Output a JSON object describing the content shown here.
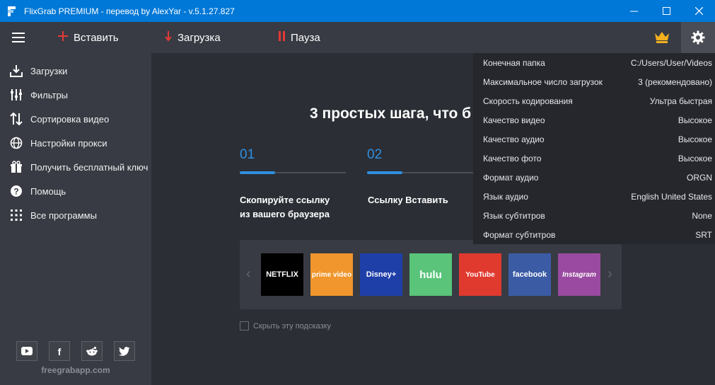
{
  "window": {
    "title": "FlixGrab PREMIUM - перевод by AlexYar - v.5.1.27.827",
    "controls": {
      "minimize": "—",
      "maximize": "☐",
      "close": "✕"
    }
  },
  "toolbar": {
    "paste_label": "Вставить",
    "download_label": "Загрузка",
    "pause_label": "Пауза",
    "icons": {
      "menu": "hamburger-icon",
      "paste": "plus-icon",
      "download": "arrow-down-icon",
      "pause": "pause-icon",
      "premium": "crown-icon",
      "settings": "gear-icon"
    },
    "colors": {
      "accent_red": "#e53935",
      "crown": "#f2b01e"
    }
  },
  "sidebar": {
    "items": [
      {
        "label": "Загрузки",
        "icon": "download-icon"
      },
      {
        "label": "Фильтры",
        "icon": "filters-icon"
      },
      {
        "label": "Сортировка видео",
        "icon": "sort-icon"
      },
      {
        "label": "Настройки прокси",
        "icon": "globe-icon"
      },
      {
        "label": "Получить бесплатный ключ",
        "icon": "gift-icon"
      },
      {
        "label": "Помощь",
        "icon": "help-icon"
      },
      {
        "label": "Все программы",
        "icon": "grid-icon"
      }
    ],
    "social": [
      "youtube-icon",
      "facebook-icon",
      "reddit-icon",
      "twitter-icon"
    ],
    "site": "freegrabapp.com"
  },
  "main": {
    "title": "3 простых шага, что б",
    "steps": [
      {
        "num": "01",
        "text_line1": "Скопируйте ссылку",
        "text_line2": "из вашего браузера"
      },
      {
        "num": "02",
        "text_line1": "Ссылку Вставить",
        "text_line2": ""
      }
    ],
    "services": [
      {
        "label": "NETFLIX",
        "color": "#000000",
        "text_color": "#ffffff"
      },
      {
        "label": "prime video",
        "color": "#f0962c",
        "text_color": "#ffffff"
      },
      {
        "label": "Disney+",
        "color": "#1f3fa8",
        "text_color": "#ffffff"
      },
      {
        "label": "hulu",
        "color": "#59c47a",
        "text_color": "#ffffff"
      },
      {
        "label": "YouTube",
        "color": "#e03a2f",
        "text_color": "#ffffff"
      },
      {
        "label": "facebook",
        "color": "#3b5ba5",
        "text_color": "#ffffff"
      },
      {
        "label": "Instagram",
        "color": "#9a4aa0",
        "text_color": "#ffffff"
      }
    ],
    "hide_hint_label": "Скрыть эту подсказку"
  },
  "settings_panel": [
    {
      "label": "Конечная папка",
      "value": "C:/Users/User/Videos"
    },
    {
      "label": "Максимальное число загрузок",
      "value": "3 (рекомендовано)"
    },
    {
      "label": "Скорость кодирования",
      "value": "Ультра быстрая"
    },
    {
      "label": "Качество видео",
      "value": "Высокое"
    },
    {
      "label": "Качество аудио",
      "value": "Высокое"
    },
    {
      "label": "Качество фото",
      "value": "Высокое"
    },
    {
      "label": "Формат аудио",
      "value": "ORGN"
    },
    {
      "label": "Язык аудио",
      "value": "English United States"
    },
    {
      "label": "Язык субтитров",
      "value": "None"
    },
    {
      "label": "Формат субтитров",
      "value": "SRT"
    }
  ]
}
